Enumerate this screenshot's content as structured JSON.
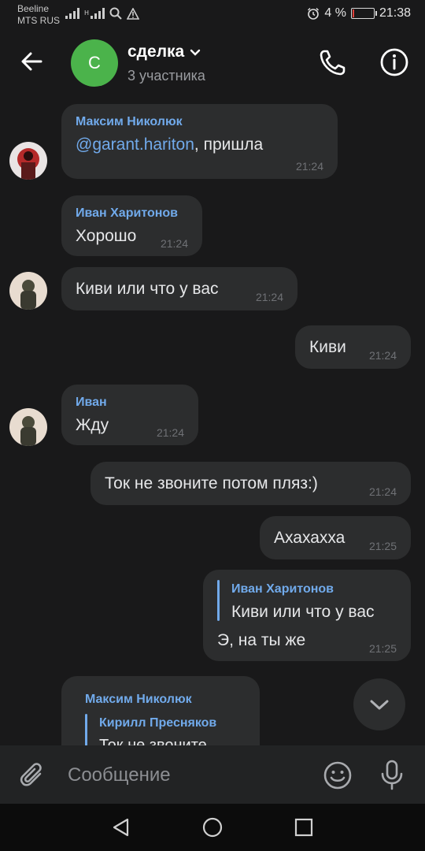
{
  "status_bar": {
    "carrier_line1": "Beeline",
    "carrier_line2": "MTS RUS",
    "battery_text": "4 %",
    "battery_level": 0.04,
    "time": "21:38"
  },
  "header": {
    "avatar_letter": "С",
    "avatar_color": "#4bb34b",
    "title": "сделка",
    "subtitle": "3 участника"
  },
  "messages": [
    {
      "author": "Максим Николюк",
      "mention": "@garant.hariton",
      "text": ",  пришла",
      "time": "21:24"
    },
    {
      "author": "Иван Харитонов",
      "text": "Хорошо",
      "time": "21:24"
    },
    {
      "text": "Киви или что у вас",
      "time": "21:24"
    },
    {
      "text": "Киви",
      "time": "21:24"
    },
    {
      "author": "Иван",
      "text": "Жду",
      "time": "21:24"
    },
    {
      "text": "Ток не звоните потом пляз:)",
      "time": "21:24"
    },
    {
      "text": "Ахахахха",
      "time": "21:25"
    },
    {
      "reply_author": "Иван Харитонов",
      "reply_text": "Киви или что у вас",
      "text": "Э, на ты же",
      "time": "21:25"
    },
    {
      "author": "Максим Николюк",
      "reply_author": "Кирилл Пресняков",
      "reply_text": "Ток не звоните"
    }
  ],
  "composer": {
    "placeholder": "Сообщение"
  },
  "colors": {
    "background": "#19191a",
    "bubble": "#2c2d2e",
    "accent": "#71aaeb"
  }
}
